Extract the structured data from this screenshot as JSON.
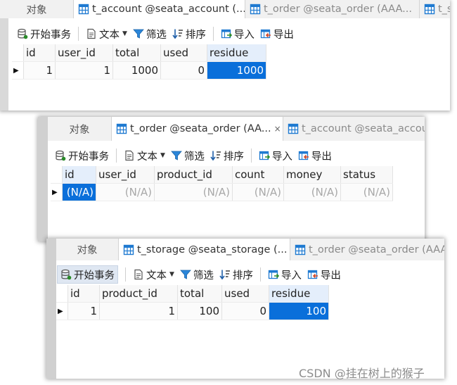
{
  "colors": {
    "accent": "#0a6fda",
    "null_text": "#a8a8a8",
    "icon_blue": "#1f7ad1"
  },
  "windows": [
    {
      "tabs": [
        {
          "label": "对象"
        },
        {
          "label": "t_account @seata_account (...",
          "icon": "grid-icon"
        },
        {
          "label": "t_order @seata_order (AAA...",
          "icon": "grid-icon"
        },
        {
          "label": "t_s",
          "icon": "grid-icon"
        }
      ],
      "toolbar": {
        "begin": "开始事务",
        "text": "文本",
        "filter": "筛选",
        "sort": "排序",
        "import": "导入",
        "export": "导出"
      },
      "columns": [
        "id",
        "user_id",
        "total",
        "used",
        "residue"
      ],
      "rows": [
        [
          "1",
          "1",
          "1000",
          "0",
          "1000"
        ]
      ]
    },
    {
      "tabs": [
        {
          "label": "对象"
        },
        {
          "label": "t_order @seata_order (AA...",
          "icon": "grid-icon",
          "close": "×"
        },
        {
          "label": "t_account @seata_accou",
          "icon": "grid-icon"
        }
      ],
      "toolbar": {
        "begin": "开始事务",
        "text": "文本",
        "filter": "筛选",
        "sort": "排序",
        "import": "导入",
        "export": "导出"
      },
      "columns": [
        "id",
        "user_id",
        "product_id",
        "count",
        "money",
        "status"
      ],
      "rows": [
        [
          "(N/A)",
          "(N/A)",
          "(N/A)",
          "(N/A)",
          "(N/A)",
          "(N/A)"
        ]
      ]
    },
    {
      "tabs": [
        {
          "label": "对象"
        },
        {
          "label": "t_storage @seata_storage (...",
          "icon": "grid-icon"
        },
        {
          "label": "t_order @seata_order (AAA",
          "icon": "grid-icon"
        }
      ],
      "toolbar": {
        "begin": "开始事务",
        "text": "文本",
        "filter": "筛选",
        "sort": "排序",
        "import": "导入",
        "export": "导出"
      },
      "columns": [
        "id",
        "product_id",
        "total",
        "used",
        "residue"
      ],
      "rows": [
        [
          "1",
          "1",
          "100",
          "0",
          "100"
        ]
      ]
    }
  ],
  "watermark": "CSDN @挂在树上的猴子"
}
